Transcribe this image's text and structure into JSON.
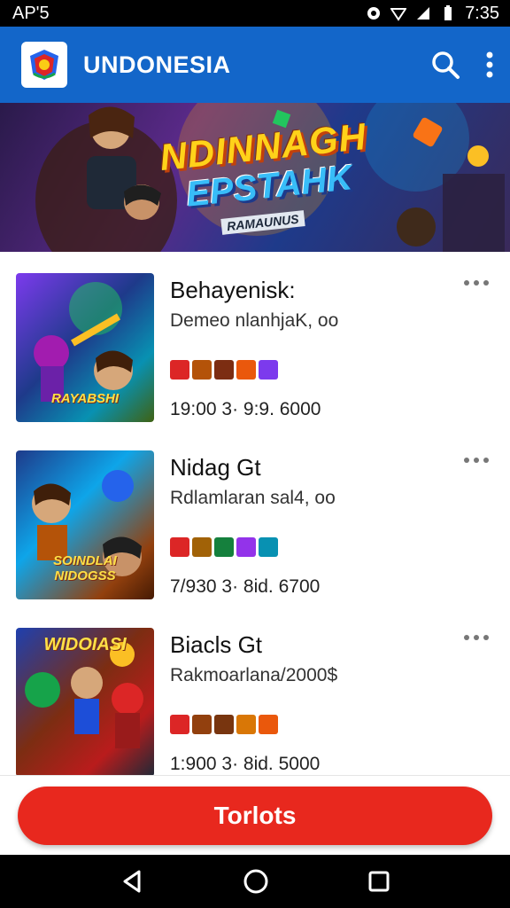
{
  "status_bar": {
    "carrier": "AP'5",
    "time": "7:35"
  },
  "app_bar": {
    "title": "UNDONESIA",
    "logo_icon": "app-logo-crest",
    "search_icon": "search-icon",
    "menu_icon": "more-vertical-icon"
  },
  "banner": {
    "title": "NDINNAGH",
    "subtitle": "EPSTAHK",
    "tag": "RAMAUNUS"
  },
  "games": [
    {
      "title": "Behayenisk:",
      "subtitle": "Demeo nlanhjaK, oo",
      "stats": "19:00 3· 9:9. 6000",
      "thumb_text": "RAYABSHI",
      "tag_colors": [
        "#dc2626",
        "#b45309",
        "#7c2d12",
        "#ea580c",
        "#7c3aed"
      ]
    },
    {
      "title": "Nidag Gt",
      "subtitle": "Rdlamlaran sal4, oo",
      "stats": "7/930 3· 8id. 6700",
      "thumb_text": "SOINDLAI NIDOGSS",
      "tag_colors": [
        "#dc2626",
        "#a16207",
        "#15803d",
        "#9333ea",
        "#0891b2"
      ]
    },
    {
      "title": "Biacls Gt",
      "subtitle": "Rakmoarlana/2000$",
      "stats": "1:900 3· 8id. 5000",
      "thumb_text": "WIDOIASI",
      "tag_colors": [
        "#dc2626",
        "#92400e",
        "#78350f",
        "#d97706",
        "#ea580c"
      ]
    }
  ],
  "cta": {
    "label": "Torlots"
  },
  "nav": {
    "back_icon": "back-icon",
    "home_icon": "home-icon",
    "recents_icon": "recents-icon"
  }
}
